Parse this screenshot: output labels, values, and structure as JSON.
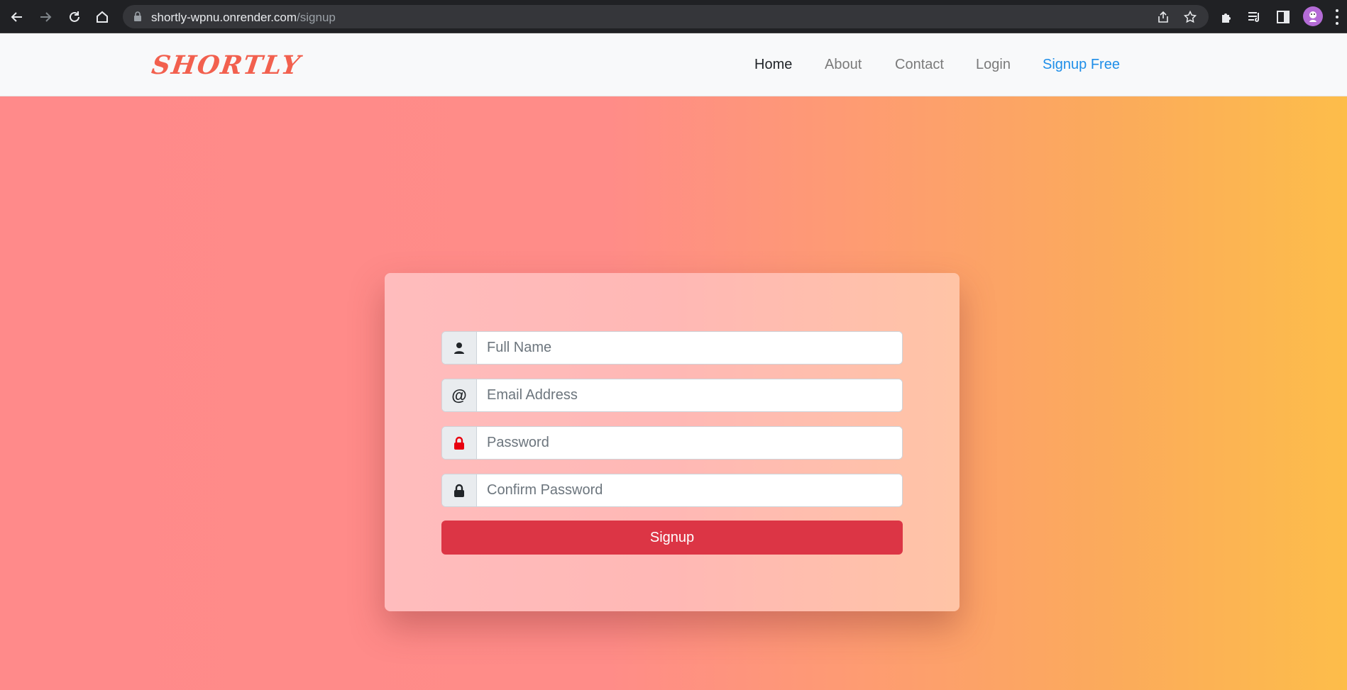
{
  "browser": {
    "url_host": "shortly-wpnu.onrender.com",
    "url_path": "/signup"
  },
  "navbar": {
    "brand": "SHORTLY",
    "links": [
      {
        "label": "Home"
      },
      {
        "label": "About"
      },
      {
        "label": "Contact"
      },
      {
        "label": "Login"
      },
      {
        "label": "Signup Free"
      }
    ]
  },
  "form": {
    "fields": [
      {
        "icon": "user-icon",
        "placeholder": "Full Name",
        "value": ""
      },
      {
        "icon": "at-icon",
        "placeholder": "Email Address",
        "value": "",
        "addon_text": "@"
      },
      {
        "icon": "lock-icon",
        "placeholder": "Password",
        "value": ""
      },
      {
        "icon": "lock-icon",
        "placeholder": "Confirm Password",
        "value": ""
      }
    ],
    "submit_label": "Signup"
  },
  "colors": {
    "brand": "#f2604e",
    "signup_link": "#1e8ee8",
    "button": "#dc3545",
    "password_lock": "#e8000f",
    "gradient_start": "#ff8a8a",
    "gradient_end": "#fdbd4a"
  }
}
